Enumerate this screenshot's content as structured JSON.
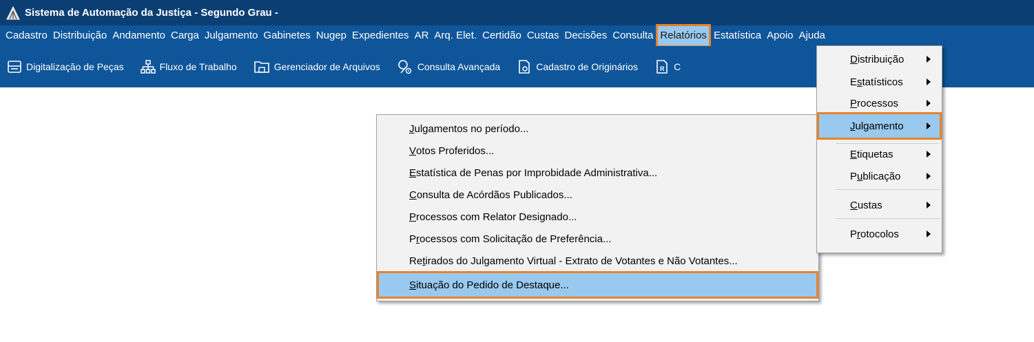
{
  "window": {
    "title": "Sistema de Automação da Justiça - Segundo Grau -"
  },
  "menubar": {
    "items": [
      {
        "label": "Cadastro"
      },
      {
        "label": "Distribuição"
      },
      {
        "label": "Andamento"
      },
      {
        "label": "Carga"
      },
      {
        "label": "Julgamento"
      },
      {
        "label": "Gabinetes"
      },
      {
        "label": "Nugep"
      },
      {
        "label": "Expedientes"
      },
      {
        "label": "AR"
      },
      {
        "label": "Arq. Elet."
      },
      {
        "label": "Certidão"
      },
      {
        "label": "Custas"
      },
      {
        "label": "Decisões"
      },
      {
        "label": "Consulta"
      },
      {
        "label": "Relatórios",
        "active": true
      },
      {
        "label": "Estatística"
      },
      {
        "label": "Apoio"
      },
      {
        "label": "Ajuda"
      }
    ]
  },
  "toolbar": {
    "digitalizacao": "Digitalização de Peças",
    "fluxo": "Fluxo de Trabalho",
    "gerenciador": "Gerenciador de Arquivos",
    "consulta_avancada": "Consulta Avançada",
    "cadastro_originarios": "Cadastro de Originários",
    "truncated": "C"
  },
  "relatorios_menu": {
    "items": [
      {
        "pre": "",
        "u": "D",
        "post": "istribuição"
      },
      {
        "pre": "E",
        "u": "s",
        "post": "tatísticos"
      },
      {
        "pre": "",
        "u": "P",
        "post": "rocessos"
      },
      {
        "pre": "",
        "u": "J",
        "post": "ulgamento",
        "highlight": true
      },
      {
        "pre": "",
        "u": "E",
        "post": "tiquetas"
      },
      {
        "pre": "P",
        "u": "u",
        "post": "blicação"
      },
      {
        "pre": "",
        "u": "C",
        "post": "ustas"
      },
      {
        "pre": "P",
        "u": "r",
        "post": "otocolos"
      }
    ]
  },
  "julgamento_submenu": {
    "items": [
      {
        "pre": "",
        "u": "J",
        "post": "ulgamentos no período..."
      },
      {
        "pre": "",
        "u": "V",
        "post": "otos Proferidos..."
      },
      {
        "pre": "",
        "u": "E",
        "post": "statística de Penas por Improbidade Administrativa..."
      },
      {
        "pre": "",
        "u": "C",
        "post": "onsulta de Acórdãos Publicados..."
      },
      {
        "pre": "",
        "u": "P",
        "post": "rocessos com Relator Designado..."
      },
      {
        "pre": "P",
        "u": "r",
        "post": "ocessos com Solicitação de Preferência..."
      },
      {
        "pre": "Re",
        "u": "t",
        "post": "irados do Julgamento Virtual - Extrato de Votantes e Não Votantes..."
      },
      {
        "pre": "",
        "u": "S",
        "post": "ituação do Pedido de Destaque...",
        "highlight": true
      }
    ]
  },
  "colors": {
    "titlebar": "#0b3f74",
    "menubar": "#0e5599",
    "highlight": "#99c9ef",
    "focus_outline": "#e8822a"
  }
}
